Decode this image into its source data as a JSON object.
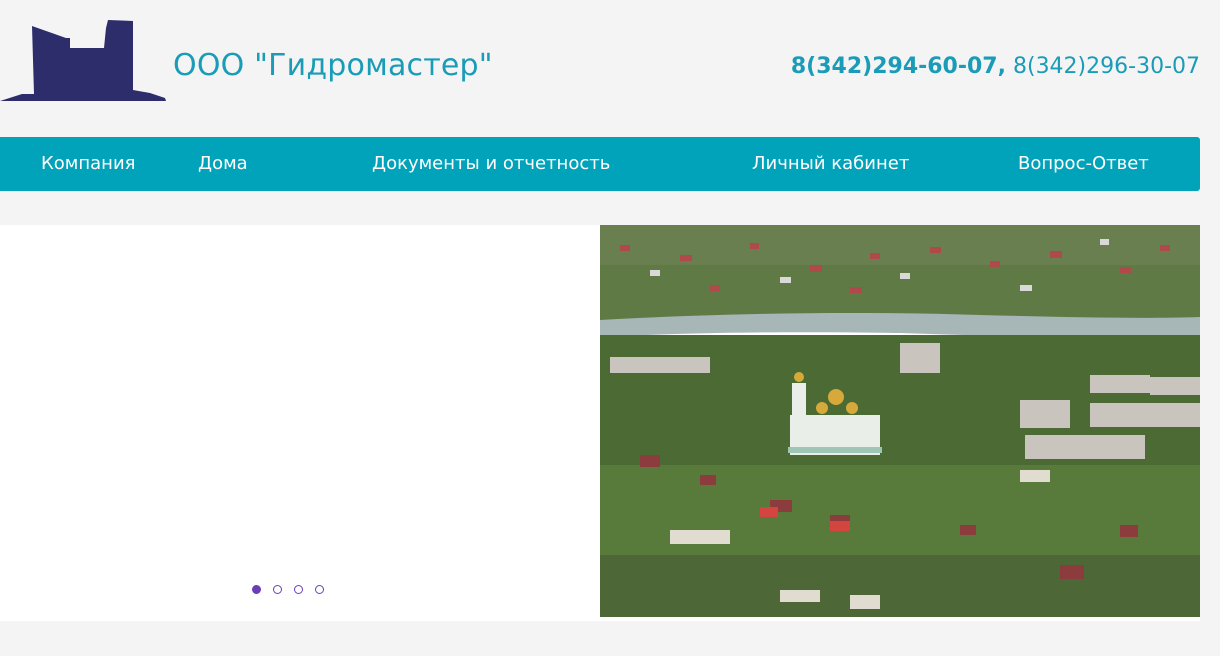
{
  "header": {
    "company_name": "ООО \"Гидромастер\"",
    "phone_main": "8(342)294-60-07",
    "phone_separator": ",",
    "phone_alt": "8(342)296-30-07",
    "logo_icon": "city-buildings-logo-icon"
  },
  "nav": {
    "items": [
      {
        "label": "Компания"
      },
      {
        "label": "Дома"
      },
      {
        "label": "Документы и отчетность"
      },
      {
        "label": "Личный кабинет"
      },
      {
        "label": "Вопрос-Ответ"
      }
    ]
  },
  "slider": {
    "image_subject": "aerial-town-with-church",
    "slide_count": 4,
    "active_index": 0
  },
  "colors": {
    "brand_text": "#1a9cb8",
    "nav_bg": "#00a3b9",
    "logo": "#2e2d6b",
    "dot": "#6a3fb5",
    "page_bg": "#f4f4f4"
  }
}
